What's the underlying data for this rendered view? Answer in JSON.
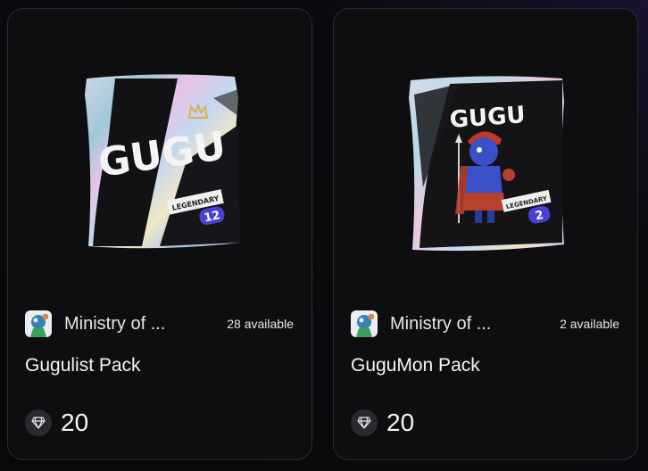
{
  "cards": [
    {
      "pack_logo": "GUGU",
      "tier": "LEGENDARY",
      "tier_count": "12",
      "creator": "Ministry of ...",
      "available": "28 available",
      "title": "Gugulist Pack",
      "price": "20"
    },
    {
      "pack_logo": "GUGU",
      "tier": "LEGENDARY",
      "tier_count": "2",
      "creator": "Ministry of ...",
      "available": "2 available",
      "title": "GuguMon Pack",
      "price": "20"
    }
  ],
  "colors": {
    "card_bg": "#0e0e10",
    "card_border": "#2c2c30",
    "badge_purple": "#4a3fd6",
    "crown_gold": "#d9b24c"
  },
  "icons": [
    "creator-avatar-icon",
    "diamond-icon",
    "crown-icon"
  ]
}
